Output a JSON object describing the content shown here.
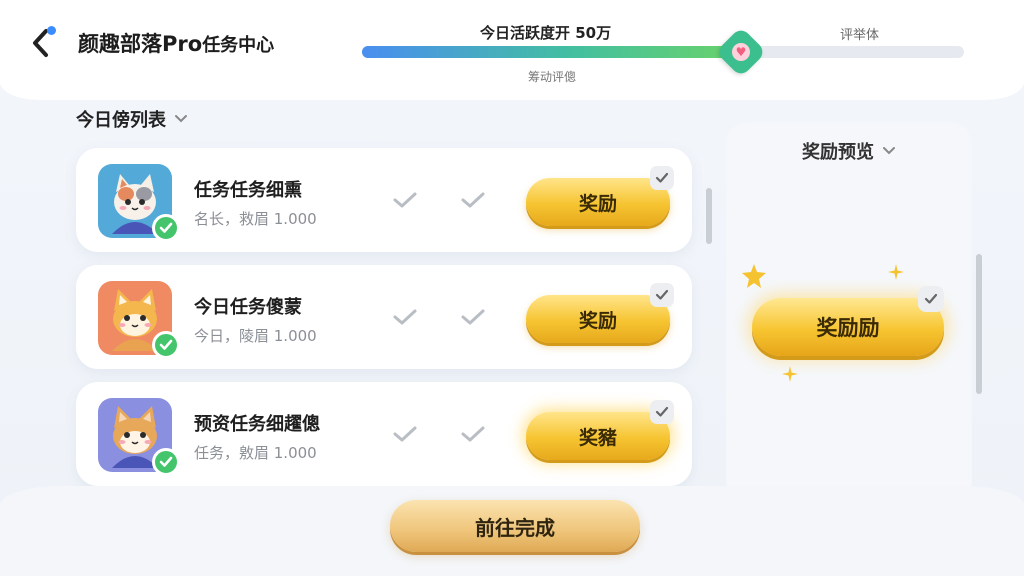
{
  "header": {
    "title": "颜趣部落Pro",
    "title_suffix": "任务中心",
    "progress_label": "今日活跃度开 50万",
    "progress_right_label": "评举体",
    "progress_sub_label": "筹动评傯",
    "progress_fraction": 0.63
  },
  "task_list": {
    "header": "今日傍列表",
    "items": [
      {
        "title": "任务任务细熏",
        "subtitle": "名长，救眉 1.000",
        "button_label": "奖励",
        "avatar_color": "#53a9d8"
      },
      {
        "title": "今日任务傻蒙",
        "subtitle": "今日，陵眉 1.000",
        "button_label": "奖励",
        "avatar_color": "#f08a62"
      },
      {
        "title": "预资任务细趯傯",
        "subtitle": "任务，敫眉 1.000",
        "button_label": "奖豬",
        "avatar_color": "#8a8fe0"
      }
    ]
  },
  "preview": {
    "header": "奖励预览",
    "button_label": "奖励励"
  },
  "footer": {
    "go_button_label": "前往完成"
  },
  "colors": {
    "accent_green": "#45c56b",
    "gold": "#f6c431",
    "back_dot": "#3a8cff"
  }
}
